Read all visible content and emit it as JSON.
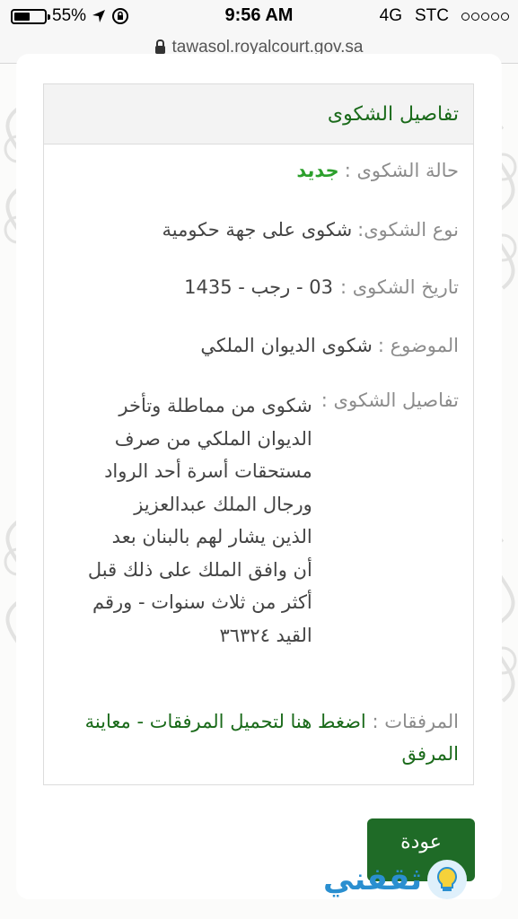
{
  "status_bar": {
    "battery": "55%",
    "time": "9:56 AM",
    "network": "4G",
    "carrier": "STC"
  },
  "browser": {
    "url": "tawasol.royalcourt.gov.sa"
  },
  "panel": {
    "title": "تفاصيل الشكوى",
    "status_label": "حالة الشكوى :",
    "status_value": "جديد",
    "type_label": "نوع الشكوى:",
    "type_value": "شكوى على جهة حكومية",
    "date_label": "تاريخ الشكوى :",
    "date_value": "03 - رجب - 1435",
    "subject_label": "الموضوع :",
    "subject_value": "شكوى الديوان الملكي",
    "details_label": "تفاصيل الشكوى :",
    "details_value": "شكوى من مماطلة وتأخر الديوان الملكي من صرف مستحقات أسرة أحد الرواد ورجال الملك عبدالعزيز الذين يشار لهم بالبنان بعد أن وافق الملك على ذلك قبل أكثر من ثلاث سنوات - ورقم القيد ٣٦٣٢٤",
    "attachments_label": "المرفقات :",
    "attachments_link": "اضغط هنا لتحميل المرفقات - معاينة المرفق"
  },
  "back_button": "عودة",
  "watermark": "ثقفني"
}
